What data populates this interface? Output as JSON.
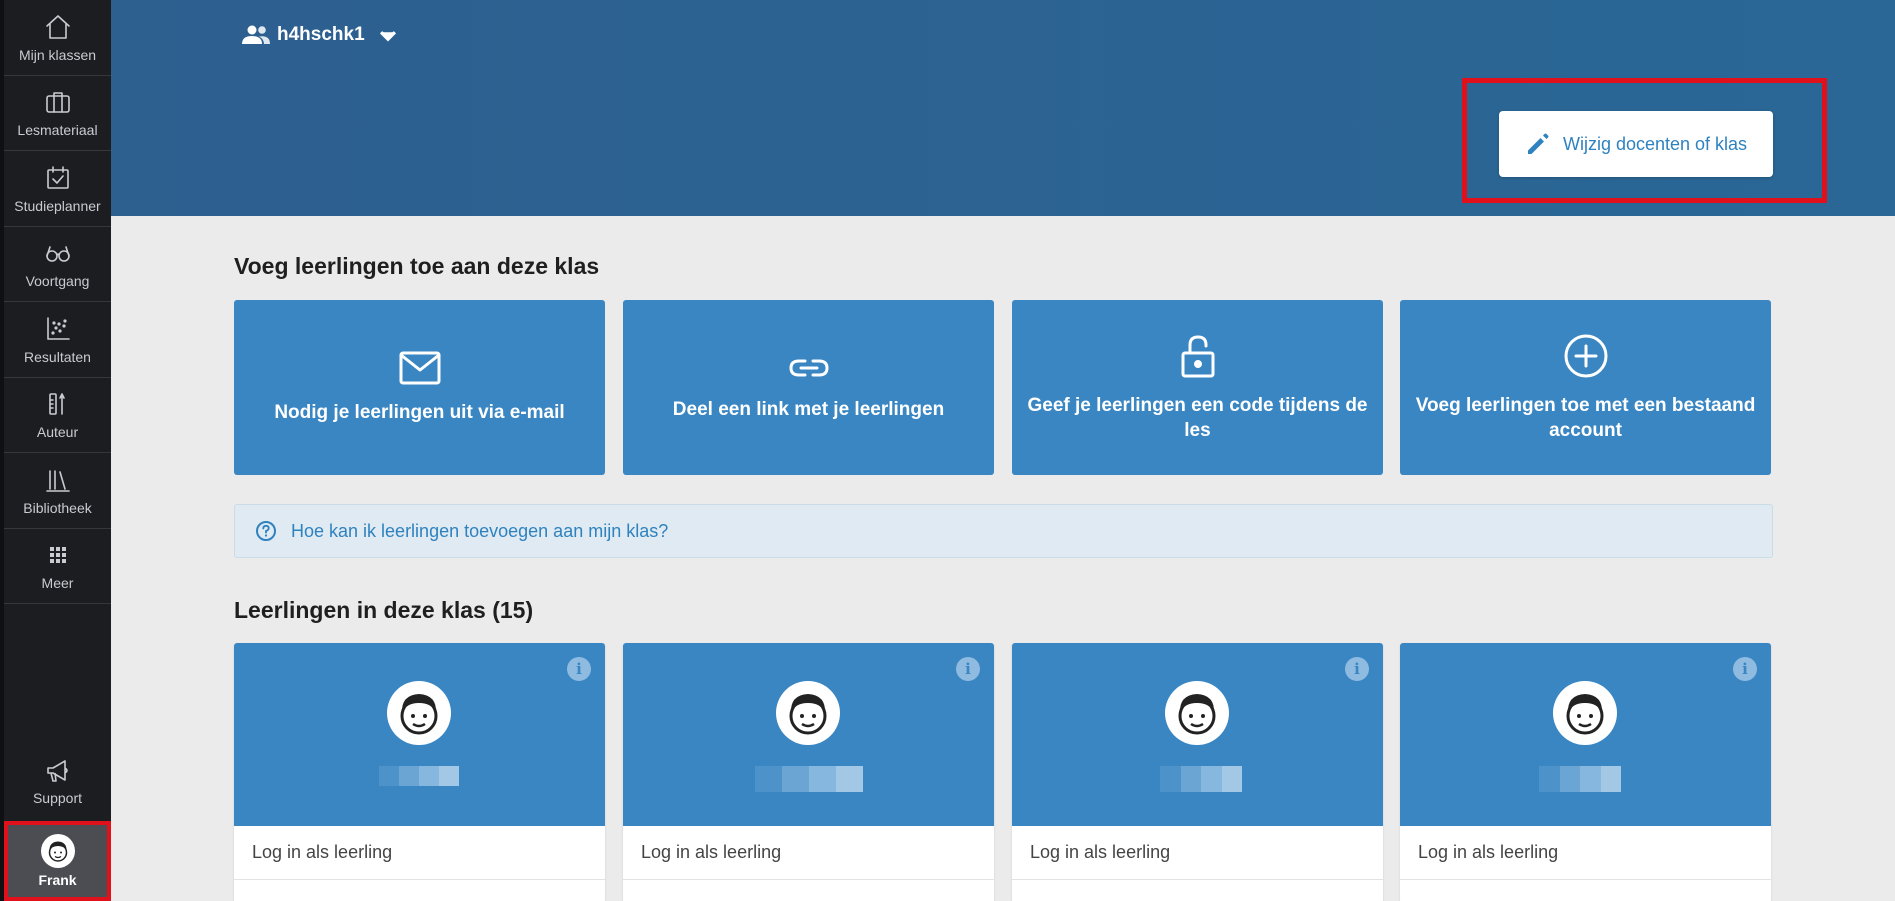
{
  "sidebar": {
    "items": [
      {
        "label": "Mijn klassen",
        "icon": "home-icon"
      },
      {
        "label": "Lesmateriaal",
        "icon": "briefcase-icon"
      },
      {
        "label": "Studieplanner",
        "icon": "calendar-check-icon"
      },
      {
        "label": "Voortgang",
        "icon": "glasses-icon"
      },
      {
        "label": "Resultaten",
        "icon": "scatter-chart-icon"
      },
      {
        "label": "Auteur",
        "icon": "author-tools-icon"
      },
      {
        "label": "Bibliotheek",
        "icon": "library-icon"
      },
      {
        "label": "Meer",
        "icon": "grid-icon"
      }
    ],
    "support_label": "Support",
    "user_name": "Frank"
  },
  "header": {
    "class_name": "h4hschk1",
    "edit_button_label": "Wijzig docenten of klas"
  },
  "add_students": {
    "title": "Voeg leerlingen toe aan deze klas",
    "cards": [
      {
        "label": "Nodig je leerlingen uit via e-mail",
        "icon": "mail-icon"
      },
      {
        "label": "Deel een link met je leerlingen",
        "icon": "link-icon"
      },
      {
        "label": "Geef je leerlingen een code tijdens de les",
        "icon": "unlock-icon"
      },
      {
        "label": "Voeg leerlingen toe met een bestaand account",
        "icon": "plus-circle-icon"
      }
    ],
    "help_text": "Hoe kan ik leerlingen toevoegen aan mijn klas?"
  },
  "students": {
    "title": "Leerlingen in deze klas (15)",
    "cards": [
      {
        "login_label": "Log in als leerling"
      },
      {
        "login_label": "Log in als leerling"
      },
      {
        "login_label": "Log in als leerling"
      },
      {
        "login_label": "Log in als leerling"
      }
    ]
  },
  "colors": {
    "sidebar_bg": "#1c1d21",
    "header_bg": "#2a6796",
    "card_blue": "#3986c3",
    "highlight_red": "#e0111b",
    "link_blue": "#2e82bf"
  }
}
